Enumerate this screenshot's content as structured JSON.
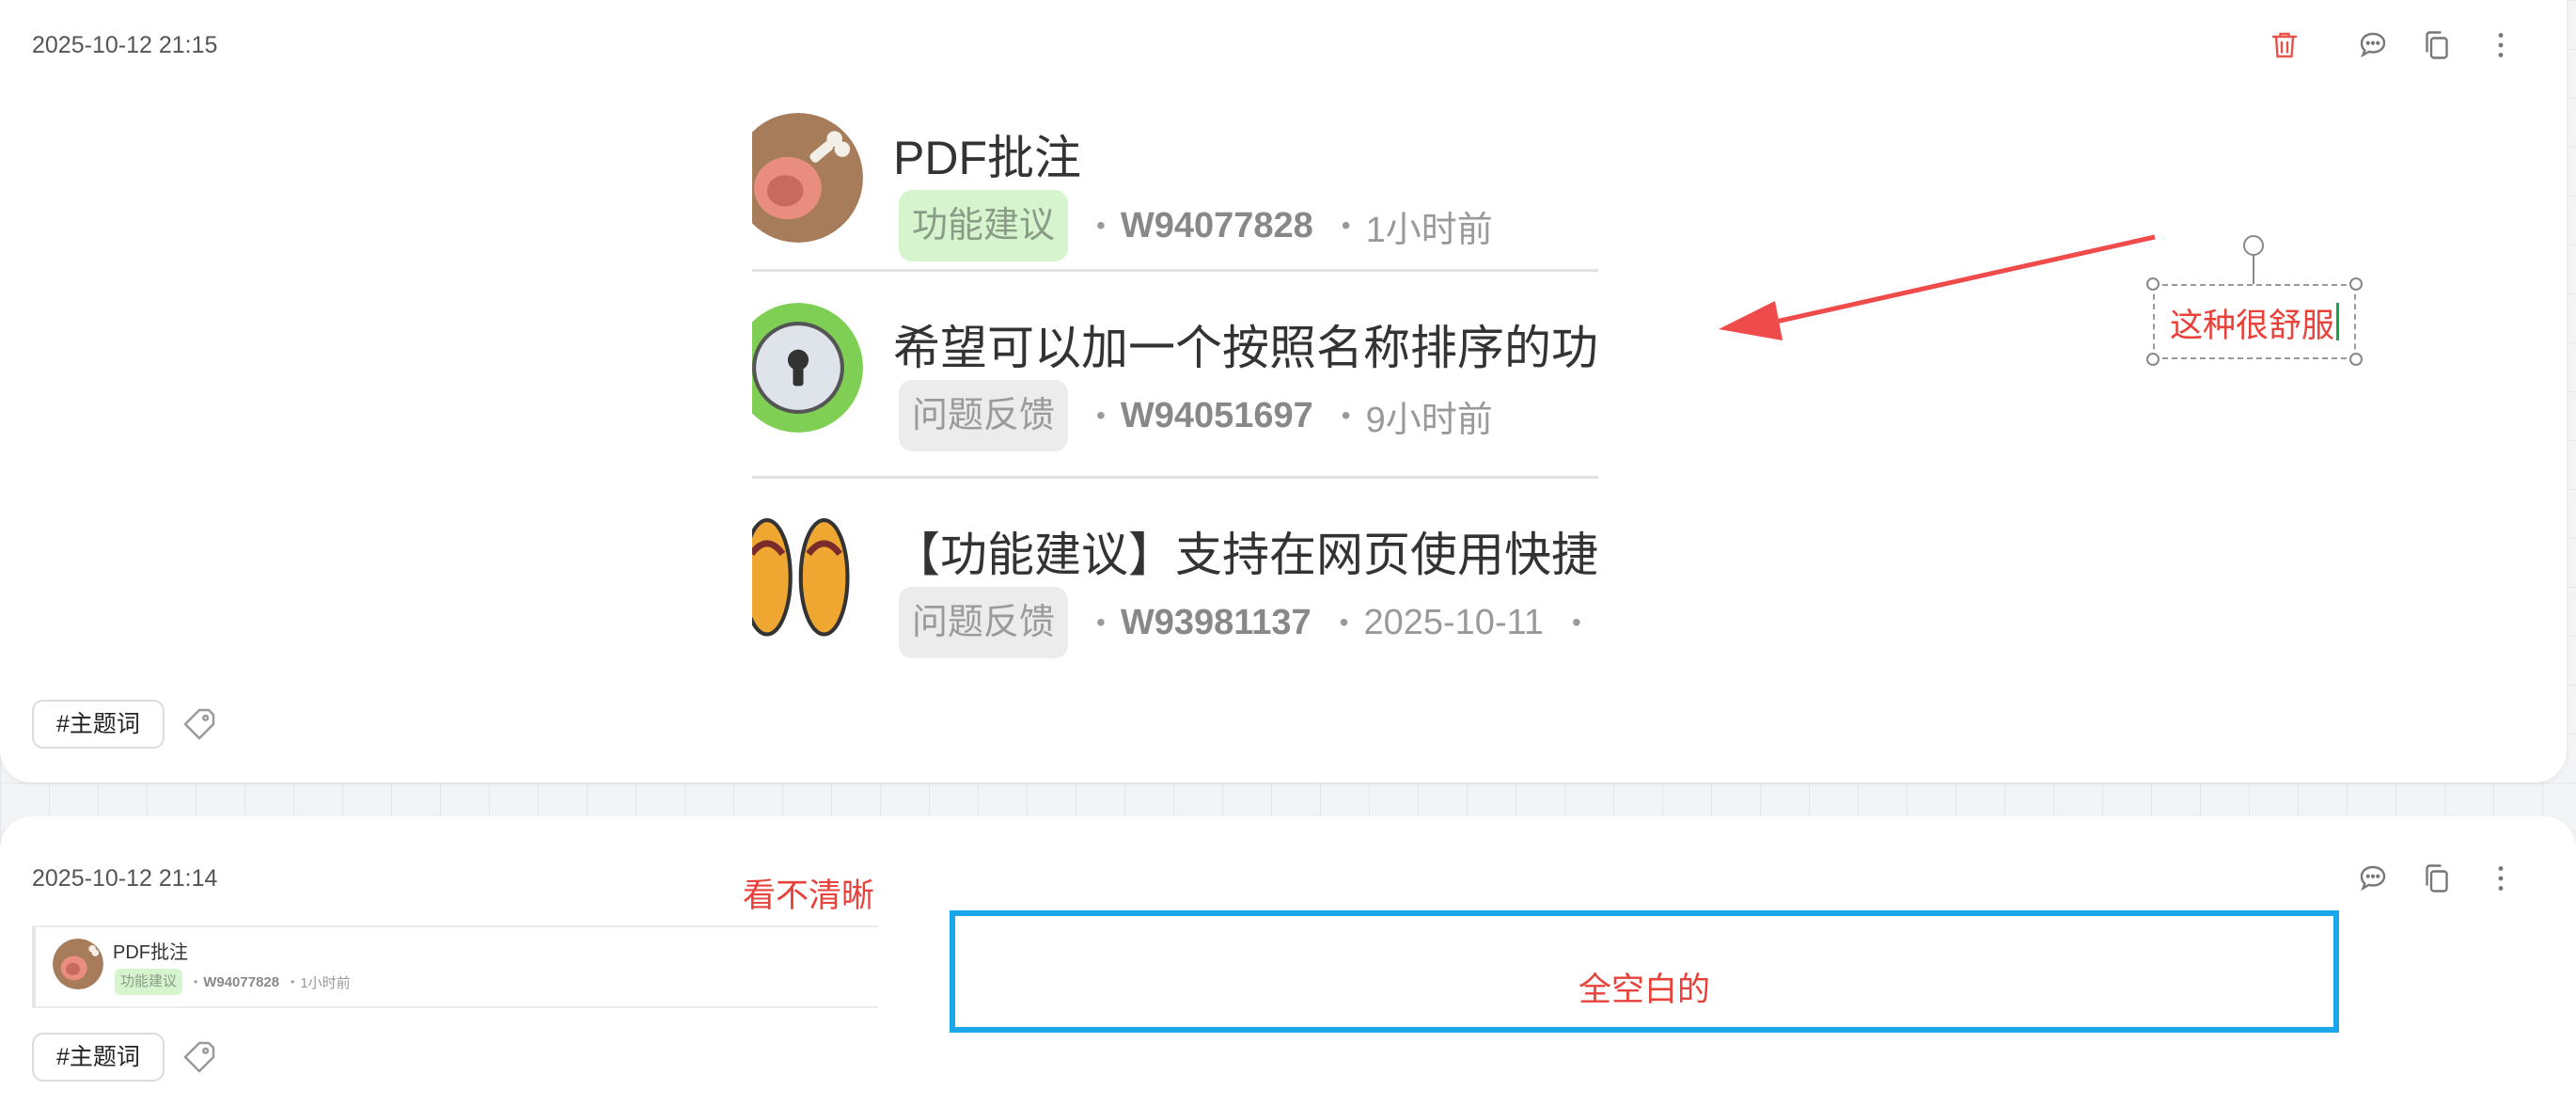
{
  "cards": [
    {
      "timestamp": "2025-10-12 21:15",
      "tag": "#主题词",
      "preview": {
        "rows": [
          {
            "title": "PDF批注",
            "badge": "功能建议",
            "badge_style": "green",
            "uid": "W94077828",
            "time": "1小时前",
            "avatar": "drumstick-avatar"
          },
          {
            "title": "希望可以加一个按照名称排序的功",
            "badge": "问题反馈",
            "badge_style": "gray",
            "uid": "W94051697",
            "time": "9小时前",
            "avatar": "keyhole-avatar"
          },
          {
            "title": "【功能建议】支持在网页使用快捷",
            "badge": "问题反馈",
            "badge_style": "gray",
            "uid": "W93981137",
            "time": "2025-10-11",
            "extra": "•",
            "avatar": "flip-flops-avatar"
          }
        ]
      },
      "annotation": "这种很舒服"
    },
    {
      "timestamp": "2025-10-12 21:14",
      "tag": "#主题词",
      "preview": {
        "rows": [
          {
            "title": "PDF批注",
            "badge": "功能建议",
            "uid": "W94077828",
            "time": "1小时前"
          }
        ]
      },
      "note": "看不清晰",
      "blank_label": "全空白的"
    }
  ],
  "colors": {
    "annotation_red": "#e8413a",
    "delete_red": "#e5534b",
    "frame_blue": "#1aa6ea",
    "badge_green_bg": "#d6f5cf"
  }
}
